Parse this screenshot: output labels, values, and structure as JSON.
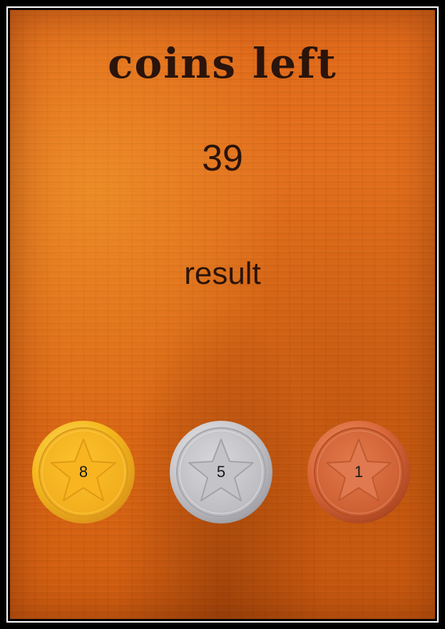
{
  "title": "coins left",
  "coins_left": "39",
  "result_label": "result",
  "coins": [
    {
      "label": "8",
      "kind": "gold",
      "icon": "star-icon",
      "color": "#f3b51c"
    },
    {
      "label": "5",
      "kind": "silver",
      "icon": "star-icon",
      "color": "#c9c9cd"
    },
    {
      "label": "1",
      "kind": "bronze",
      "icon": "star-icon",
      "color": "#d9673a"
    }
  ]
}
